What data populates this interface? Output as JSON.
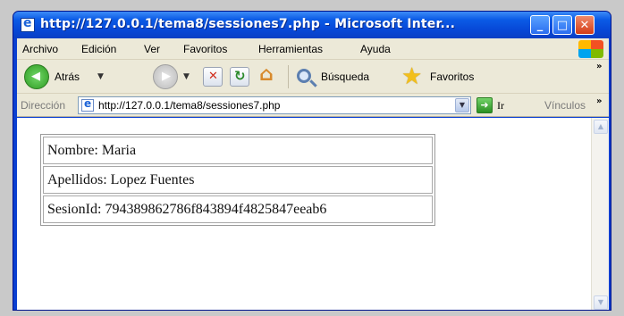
{
  "window": {
    "title": "http://127.0.0.1/tema8/sessiones7.php - Microsoft Inter...",
    "controls": {
      "minimize": "_",
      "maximize": "□",
      "close": "✕"
    }
  },
  "menubar": {
    "items": [
      "Archivo",
      "Edición",
      "Ver",
      "Favoritos",
      "Herramientas",
      "Ayuda"
    ]
  },
  "toolbar": {
    "back_label": "Atrás",
    "search_label": "Búsqueda",
    "favorites_label": "Favoritos",
    "overflow": "»",
    "icons": [
      "back-icon",
      "forward-icon",
      "stop-icon",
      "refresh-icon",
      "home-icon",
      "search-icon",
      "star-icon"
    ]
  },
  "addressbar": {
    "label": "Dirección",
    "url": "http://127.0.0.1/tema8/sessiones7.php",
    "go_label": "Ir",
    "links_label": "Vínculos",
    "overflow": "»"
  },
  "content": {
    "rows": [
      "Nombre: Maria",
      "Apellidos: Lopez Fuentes",
      "SesionId: 794389862786f843894f4825847eeab6"
    ]
  }
}
